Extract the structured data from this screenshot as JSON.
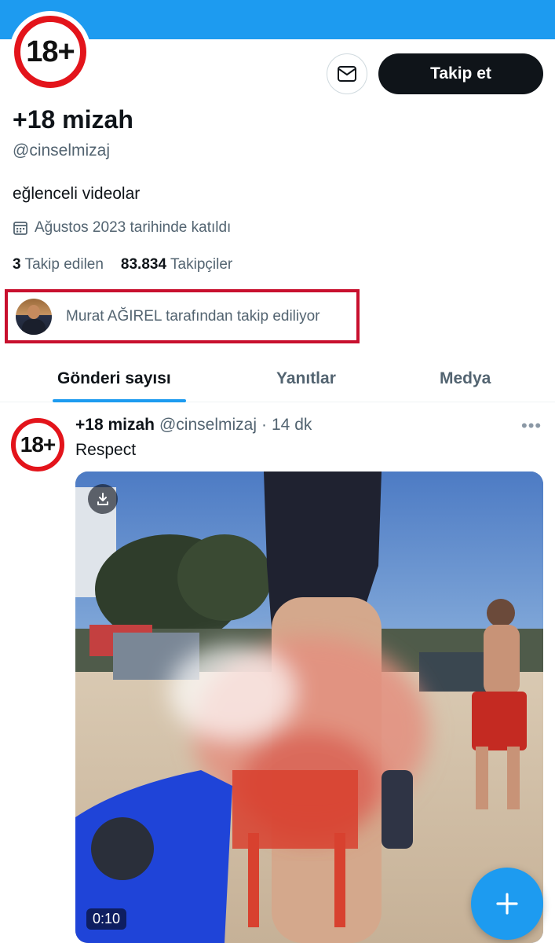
{
  "colors": {
    "accent": "#1d9bf0",
    "follow_bg": "#0f1419",
    "highlight_border": "#c8102e",
    "badge_red": "#e3141b"
  },
  "profile": {
    "avatar_text": "18+",
    "name": "+18 mizah",
    "handle": "@cinselmizaj",
    "bio": "eğlenceli videolar",
    "joined": "Ağustos 2023 tarihinde katıldı",
    "following_count": "3",
    "following_label": "Takip edilen",
    "followers_count": "83.834",
    "followers_label": "Takipçiler",
    "followed_by": "Murat AĞIREL tarafından takip ediliyor"
  },
  "actions": {
    "message_icon": "envelope-icon",
    "follow_label": "Takip et"
  },
  "tabs": [
    {
      "label": "Gönderi sayısı",
      "active": true
    },
    {
      "label": "Yanıtlar",
      "active": false
    },
    {
      "label": "Medya",
      "active": false
    }
  ],
  "post": {
    "avatar_text": "18+",
    "author": "+18 mizah",
    "handle": "@cinselmizaj",
    "separator": "·",
    "time": "14 dk",
    "more": "•••",
    "text": "Respect",
    "video_duration": "0:10",
    "download_icon": "download-icon"
  },
  "fab": {
    "icon": "plus-icon"
  }
}
